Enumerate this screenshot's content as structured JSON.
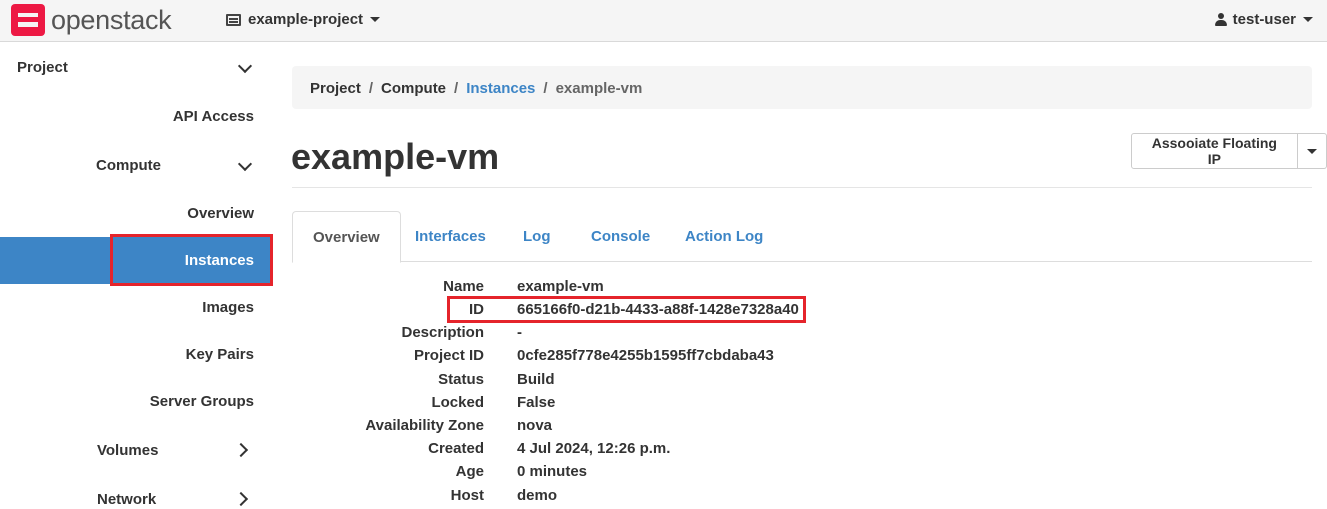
{
  "topbar": {
    "brand": "openstack",
    "project_selector": "example-project",
    "user": "test-user"
  },
  "sidebar": {
    "project_label": "Project",
    "api_access": "API Access",
    "compute_label": "Compute",
    "compute_items": [
      "Overview",
      "Instances",
      "Images",
      "Key Pairs",
      "Server Groups"
    ],
    "volumes_label": "Volumes",
    "network_label": "Network",
    "active_item": "Instances"
  },
  "breadcrumb": [
    "Project",
    "Compute",
    "Instances",
    "example-vm"
  ],
  "page": {
    "title": "example-vm",
    "action_button": "Assooiate Floating IP"
  },
  "tabs": [
    "Overview",
    "Interfaces",
    "Log",
    "Console",
    "Action Log"
  ],
  "active_tab": "Overview",
  "details": [
    {
      "label": "Name",
      "value": "example-vm"
    },
    {
      "label": "ID",
      "value": "665166f0-d21b-4433-a88f-1428e7328a40"
    },
    {
      "label": "Description",
      "value": "-"
    },
    {
      "label": "Project ID",
      "value": "0cfe285f778e4255b1595ff7cbdaba43"
    },
    {
      "label": "Status",
      "value": "Build"
    },
    {
      "label": "Locked",
      "value": "False"
    },
    {
      "label": "Availability Zone",
      "value": "nova"
    },
    {
      "label": "Created",
      "value": "4 Jul 2024, 12:26 p.m."
    },
    {
      "label": "Age",
      "value": "0 minutes"
    },
    {
      "label": "Host",
      "value": "demo"
    }
  ],
  "colors": {
    "accent": "#3d85c6",
    "brand_red": "#ed1944",
    "highlight_red": "#e5242b"
  }
}
